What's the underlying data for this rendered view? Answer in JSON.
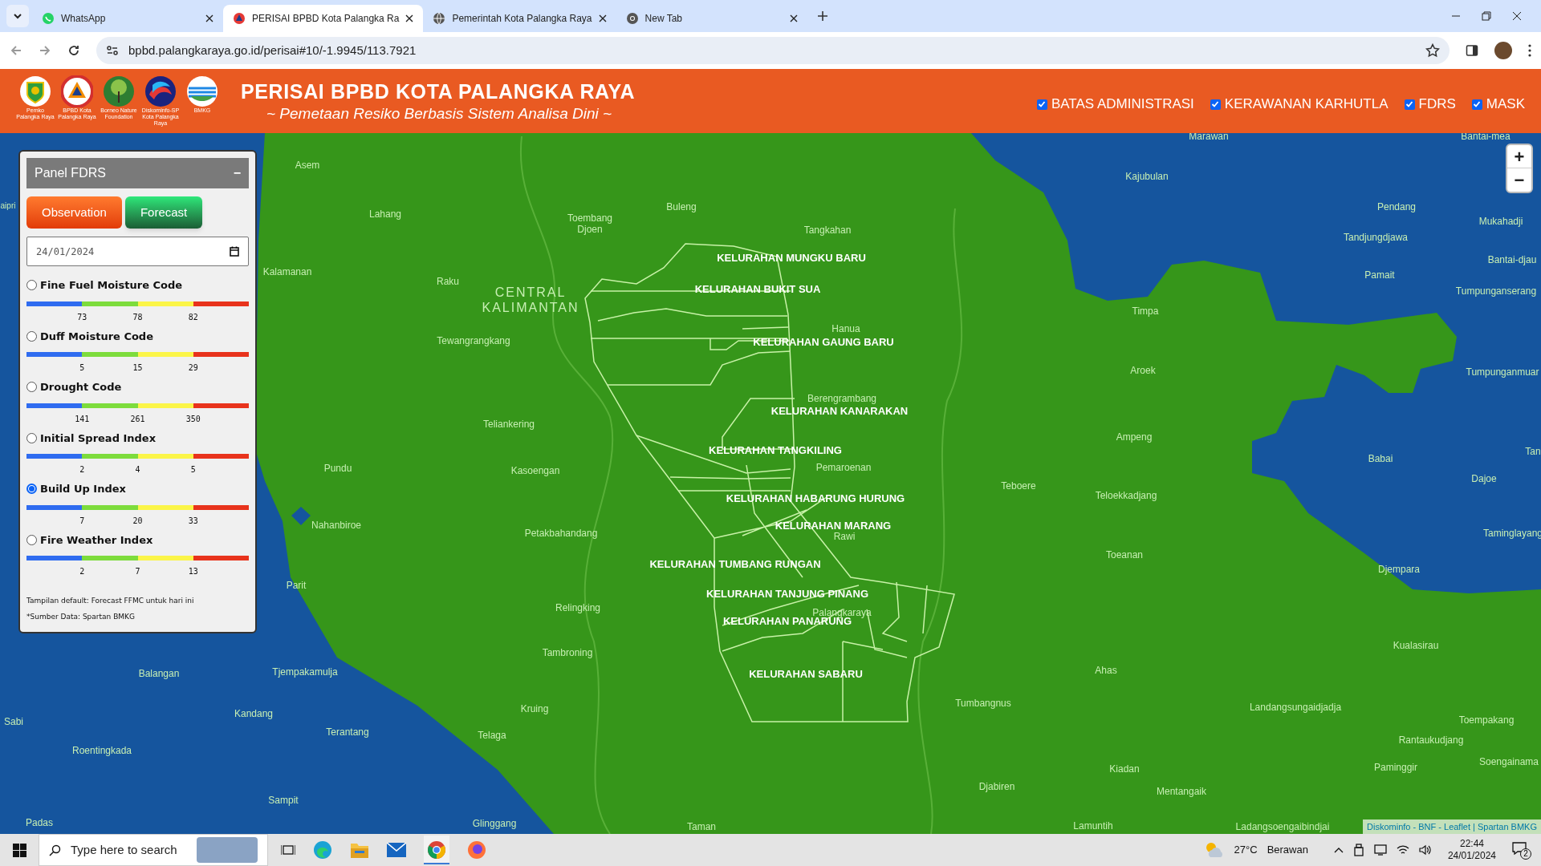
{
  "browser": {
    "tabs": [
      {
        "title": "WhatsApp",
        "kind": "whatsapp",
        "selected": false
      },
      {
        "title": "PERISAI BPBD Kota Palangka Ra",
        "kind": "site",
        "selected": true
      },
      {
        "title": "Pemerintah Kota Palangka Raya",
        "kind": "globe",
        "selected": false
      },
      {
        "title": "New Tab",
        "kind": "chrome",
        "selected": false
      }
    ],
    "url": "bpbd.palangkaraya.go.id/perisai#10/-1.9945/113.7921"
  },
  "header": {
    "logos": [
      {
        "caption": "Pemko Palangka Raya",
        "kind": "shield"
      },
      {
        "caption": "BPBD Kota Palangka Raya",
        "kind": "triangle"
      },
      {
        "caption": "Borneo Nature Foundation",
        "kind": "tree"
      },
      {
        "caption": "Diskominfo-SP Kota Palangka Raya",
        "kind": "swirl"
      },
      {
        "caption": "BMKG",
        "kind": "bmkg"
      }
    ],
    "title": "PERISAI BPBD KOTA PALANGKA RAYA",
    "subtitle": "~ Pemetaan Resiko Berbasis Sistem Analisa Dini ~",
    "layers": [
      {
        "label": "BATAS ADMINISTRASI",
        "checked": true
      },
      {
        "label": "KERAWANAN KARHUTLA",
        "checked": true
      },
      {
        "label": "FDRS",
        "checked": true
      },
      {
        "label": "MASK",
        "checked": true
      }
    ]
  },
  "panel": {
    "title": "Panel FDRS",
    "collapse": "−",
    "buttons": [
      {
        "label": "Observation",
        "kind": "observation"
      },
      {
        "label": "Forecast",
        "kind": "forecast"
      }
    ],
    "date": "24/01/2024",
    "indices": [
      {
        "name": "Fine Fuel Moisture Code",
        "selected": false,
        "ticks": [
          "73",
          "78",
          "82"
        ]
      },
      {
        "name": "Duff Moisture Code",
        "selected": false,
        "ticks": [
          "5",
          "15",
          "29"
        ]
      },
      {
        "name": "Drought Code",
        "selected": false,
        "ticks": [
          "141",
          "261",
          "350"
        ]
      },
      {
        "name": "Initial Spread Index",
        "selected": false,
        "ticks": [
          "2",
          "4",
          "5"
        ]
      },
      {
        "name": "Build Up Index",
        "selected": true,
        "ticks": [
          "7",
          "20",
          "33"
        ]
      },
      {
        "name": "Fire Weather Index",
        "selected": false,
        "ticks": [
          "2",
          "7",
          "13"
        ]
      }
    ],
    "notes": [
      "Tampilan default: Forecast FFMC untuk hari ini",
      "*Sumber Data: Spartan BMKG"
    ]
  },
  "map": {
    "zoom": [
      "+",
      "−"
    ],
    "places": [
      "Asem",
      "Lahang",
      "Toembang Djoen",
      "Buleng",
      "Tangkahan",
      "Kalamanan",
      "Raku",
      "CENTRAL KALIMANTAN",
      "Tewangrangkang",
      "Hanua",
      "Berengrambang",
      "Teliankering",
      "Pundu",
      "Kasoengan",
      "Pemaroenan",
      "Nahanbiroe",
      "Petakbahandang",
      "Rawi",
      "Parit",
      "Relingking",
      "Palangkaraya",
      "Tambroning",
      "Balangan",
      "Tjempakamulja",
      "Kandang",
      "Terantang",
      "Kruing",
      "Telaga",
      "Sabi",
      "Roentingkada",
      "Sampit",
      "Padas",
      "Glinggang",
      "Taman",
      "Lamuntih",
      "Ladangsoengaibindjai",
      "Djabiren",
      "Mentangaik",
      "Kiadan",
      "Ahas",
      "Tumbangnus",
      "Djempara",
      "Kualasirau",
      "Landangsungaidjadja",
      "Toempakang",
      "Rantaukudjang",
      "Soengainama",
      "Paminggir",
      "Kajubulan",
      "Timpa",
      "Aroek",
      "Ampeng",
      "Teboere",
      "Teloekkadjang",
      "Toeanan",
      "Marawan",
      "Bantai-mea",
      "Pendang",
      "Mukahadji",
      "Tandjungdjawa",
      "Bantai-djau",
      "Pamait",
      "Tumpunganserang",
      "Tumpunganmuar",
      "Babai",
      "Tan",
      "Dajoe",
      "Taminglayang",
      "aipri"
    ],
    "districts": [
      "KELURAHAN MUNGKU BARU",
      "KELURAHAN BUKIT SUA",
      "KELURAHAN GAUNG BARU",
      "KELURAHAN KANARAKAN",
      "KELURAHAN TANGKILING",
      "KELURAHAN HABARUNG HURUNG",
      "KELURAHAN MARANG",
      "KELURAHAN TUMBANG RUNGAN",
      "KELURAHAN TANJUNG PINANG",
      "KELURAHAN PANARUNG",
      "KELURAHAN SABARU"
    ],
    "attribution": "Diskominfo - BNF - Leaflet | Spartan BMKG"
  },
  "taskbar": {
    "search_placeholder": "Type here to search",
    "temperature": "27°C",
    "weather": "Berawan",
    "time": "22:44",
    "date": "24/01/2024",
    "notifications": "2"
  }
}
